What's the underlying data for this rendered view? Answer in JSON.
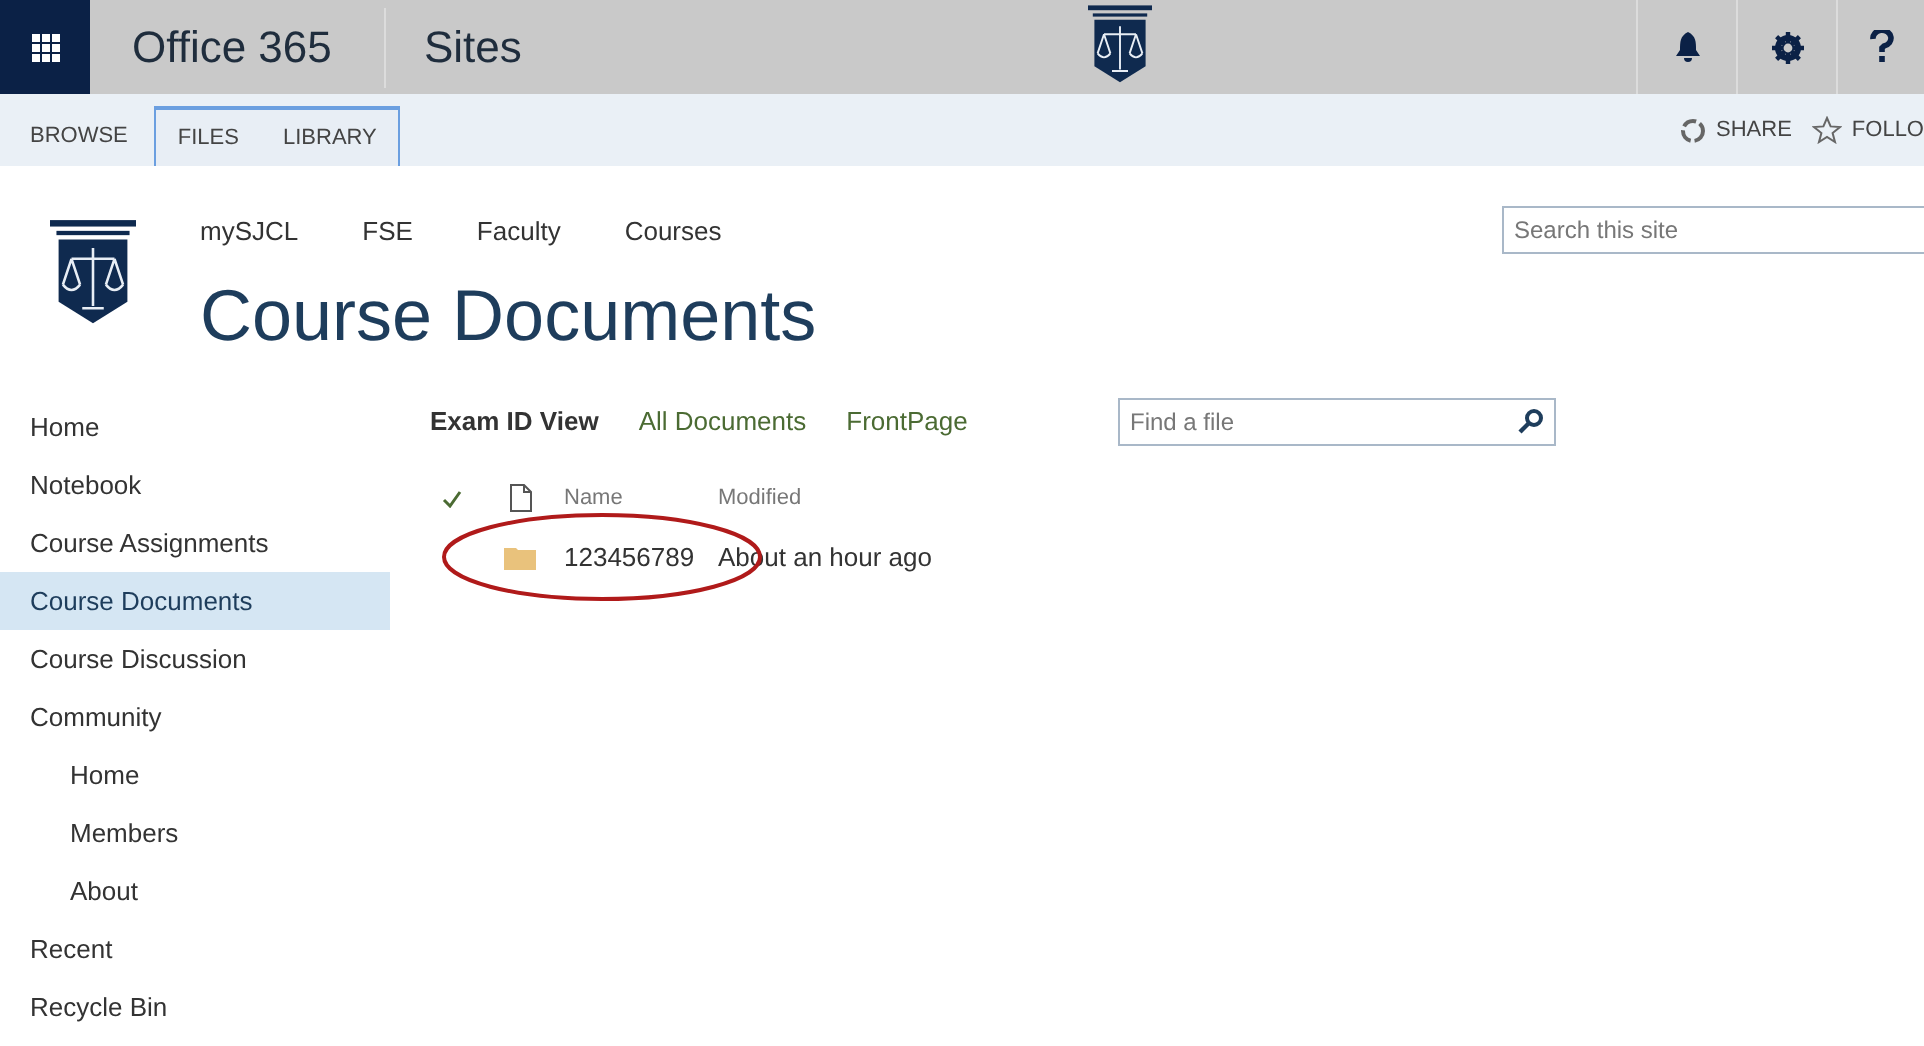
{
  "suite_bar": {
    "brand": "Office 365",
    "app": "Sites"
  },
  "ribbon": {
    "tabs": [
      {
        "label": "BROWSE",
        "kind": "standard"
      },
      {
        "label": "FILES",
        "kind": "contextual"
      },
      {
        "label": "LIBRARY",
        "kind": "contextual"
      }
    ],
    "actions": [
      {
        "label": "SHARE",
        "kind": "share"
      },
      {
        "label": "FOLLO",
        "kind": "follow"
      }
    ]
  },
  "top_nav": [
    "mySJCL",
    "FSE",
    "Faculty",
    "Courses"
  ],
  "page_title": "Course Documents",
  "site_search": {
    "placeholder": "Search this site"
  },
  "left_nav": [
    {
      "label": "Home",
      "selected": false
    },
    {
      "label": "Notebook",
      "selected": false
    },
    {
      "label": "Course Assignments",
      "selected": false
    },
    {
      "label": "Course Documents",
      "selected": true
    },
    {
      "label": "Course Discussion",
      "selected": false
    },
    {
      "label": "Community",
      "selected": false,
      "children": [
        {
          "label": "Home",
          "selected": false
        },
        {
          "label": "Members",
          "selected": false
        },
        {
          "label": "About",
          "selected": false
        }
      ]
    },
    {
      "label": "Recent",
      "selected": false
    },
    {
      "label": "Recycle Bin",
      "selected": false
    }
  ],
  "views": [
    {
      "label": "Exam ID View",
      "selected": true
    },
    {
      "label": "All Documents",
      "selected": false
    },
    {
      "label": "FrontPage",
      "selected": false
    }
  ],
  "file_search": {
    "placeholder": "Find a file"
  },
  "table": {
    "columns": [
      "Name",
      "Modified"
    ],
    "rows": [
      {
        "kind": "folder",
        "name": "123456789",
        "modified": "About an hour ago",
        "circled": true
      }
    ]
  }
}
